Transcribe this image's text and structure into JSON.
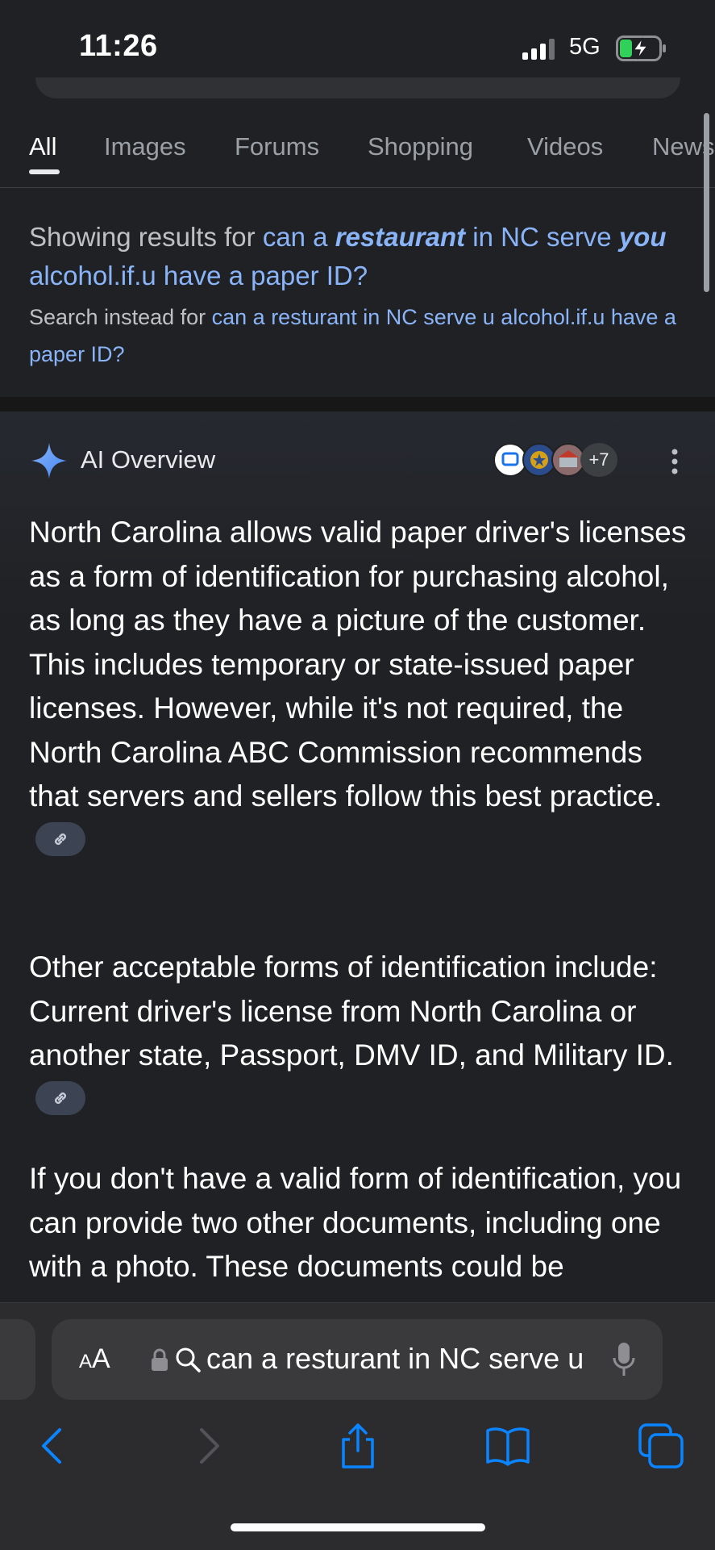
{
  "status_bar": {
    "time": "11:26",
    "network": "5G"
  },
  "tabs": [
    "All",
    "Images",
    "Forums",
    "Shopping",
    "Videos",
    "News"
  ],
  "correction": {
    "showing_prefix": "Showing results for ",
    "q1": "can a ",
    "q2": "restaurant",
    "q3": " in NC serve ",
    "q4": "you",
    "q5": " alcohol.if.u have a paper ID?",
    "instead_prefix": "Search instead for ",
    "instead_query": "can a resturant in NC serve u alcohol.if.u have a paper ID?"
  },
  "ai_overview": {
    "title": "AI Overview",
    "sources_more": "+7",
    "paragraphs": [
      "North Carolina allows valid paper driver's licenses as a form of identification for purchasing alcohol, as long as they have a picture of the customer. This includes temporary or state-issued paper licenses. However, while it's not required, the North Carolina ABC Commission recommends that servers and sellers follow this best practice.",
      "Other acceptable forms of identification include: Current driver's license from North Carolina or another state, Passport, DMV ID, and Military ID.",
      "If you don't have a valid form of identification, you can provide two other documents, including one with a photo. These documents could be"
    ]
  },
  "safari": {
    "text_size_label_small": "A",
    "text_size_label_large": "A",
    "url": "can a resturant in NC serve u alcohol.if.u have a paper ID?"
  },
  "colors": {
    "accent_link": "#8ab4f8",
    "background": "#202124",
    "safari_blue": "#0a84ff"
  },
  "icons": [
    "signal-icon",
    "battery-charging-icon",
    "sparkle-icon",
    "more-vert-icon",
    "link-icon",
    "lock-icon",
    "search-icon",
    "mic-icon",
    "back-icon",
    "forward-icon",
    "share-icon",
    "bookmarks-icon",
    "tabs-icon"
  ]
}
